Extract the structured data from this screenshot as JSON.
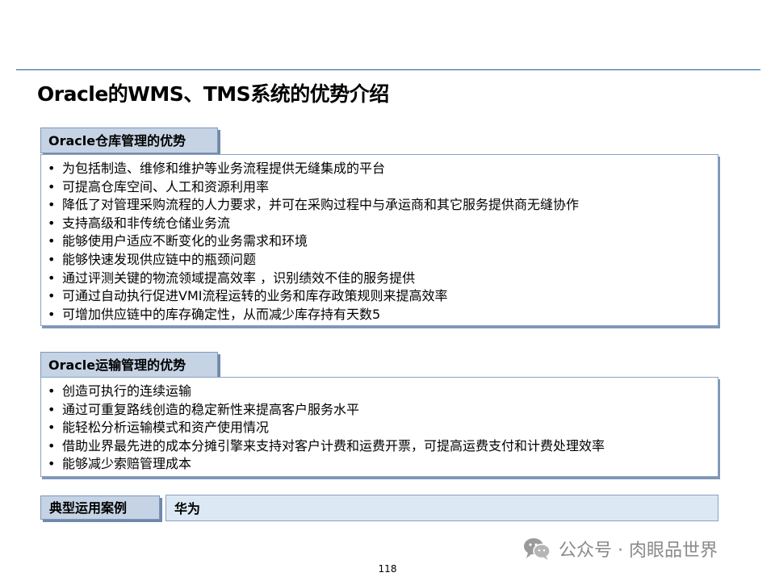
{
  "page": {
    "title": "Oracle的WMS、TMS系统的优势介绍",
    "page_number": "118"
  },
  "warehouse": {
    "header": "Oracle仓库管理的优势",
    "items": [
      "为包括制造、维修和维护等业务流程提供无缝集成的平台",
      "可提高仓库空间、人工和资源利用率",
      "降低了对管理采购流程的人力要求，并可在采购过程中与承运商和其它服务提供商无缝协作",
      "支持高级和非传统仓储业务流",
      "能够使用户适应不断变化的业务需求和环境",
      "能够快速发现供应链中的瓶颈问题",
      "通过评测关键的物流领域提高效率 ，识别绩效不佳的服务提供",
      "可通过自动执行促进VMI流程运转的业务和库存政策规则来提高效率",
      "可增加供应链中的库存确定性，从而减少库存持有天数5"
    ]
  },
  "transport": {
    "header": "Oracle运输管理的优势",
    "items": [
      "创造可执行的连续运输",
      "通过可重复路线创造的稳定新性来提高客户服务水平",
      "能轻松分析运输模式和资产使用情况",
      "借助业界最先进的成本分摊引擎来支持对客户计费和运费开票，可提高运费支付和计费处理效率",
      "能够减少索赔管理成本"
    ]
  },
  "case": {
    "label": "典型运用案例",
    "value": "华为"
  },
  "watermark": {
    "icon": "wechat-icon",
    "text": "公众号 · 肉眼品世界"
  }
}
